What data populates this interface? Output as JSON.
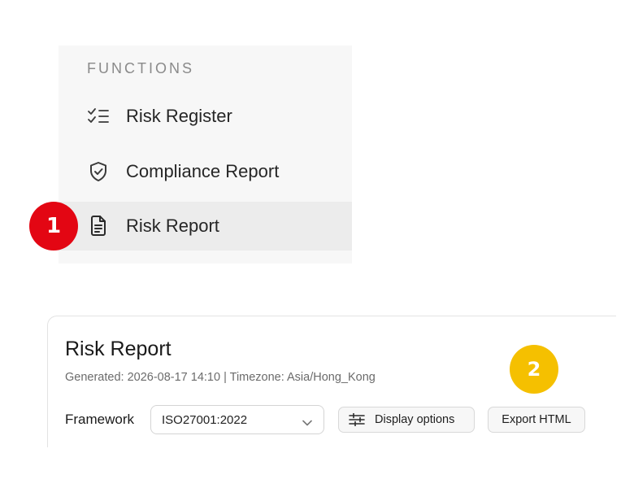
{
  "sidebar": {
    "section_title": "FUNCTIONS",
    "items": [
      {
        "label": "Risk Register",
        "icon": "checklist-icon",
        "active": false
      },
      {
        "label": "Compliance Report",
        "icon": "shield-check-icon",
        "active": false
      },
      {
        "label": "Risk Report",
        "icon": "document-icon",
        "active": true
      }
    ]
  },
  "callouts": {
    "step1": "1",
    "step2": "2",
    "step1_color": "#e30613",
    "step2_color": "#f5c000"
  },
  "report": {
    "title": "Risk Report",
    "meta": "Generated: 2026-08-17 14:10 | Timezone: Asia/Hong_Kong",
    "framework_label": "Framework",
    "framework_value": "ISO27001:2022",
    "display_options_label": "Display options",
    "export_label": "Export HTML"
  }
}
